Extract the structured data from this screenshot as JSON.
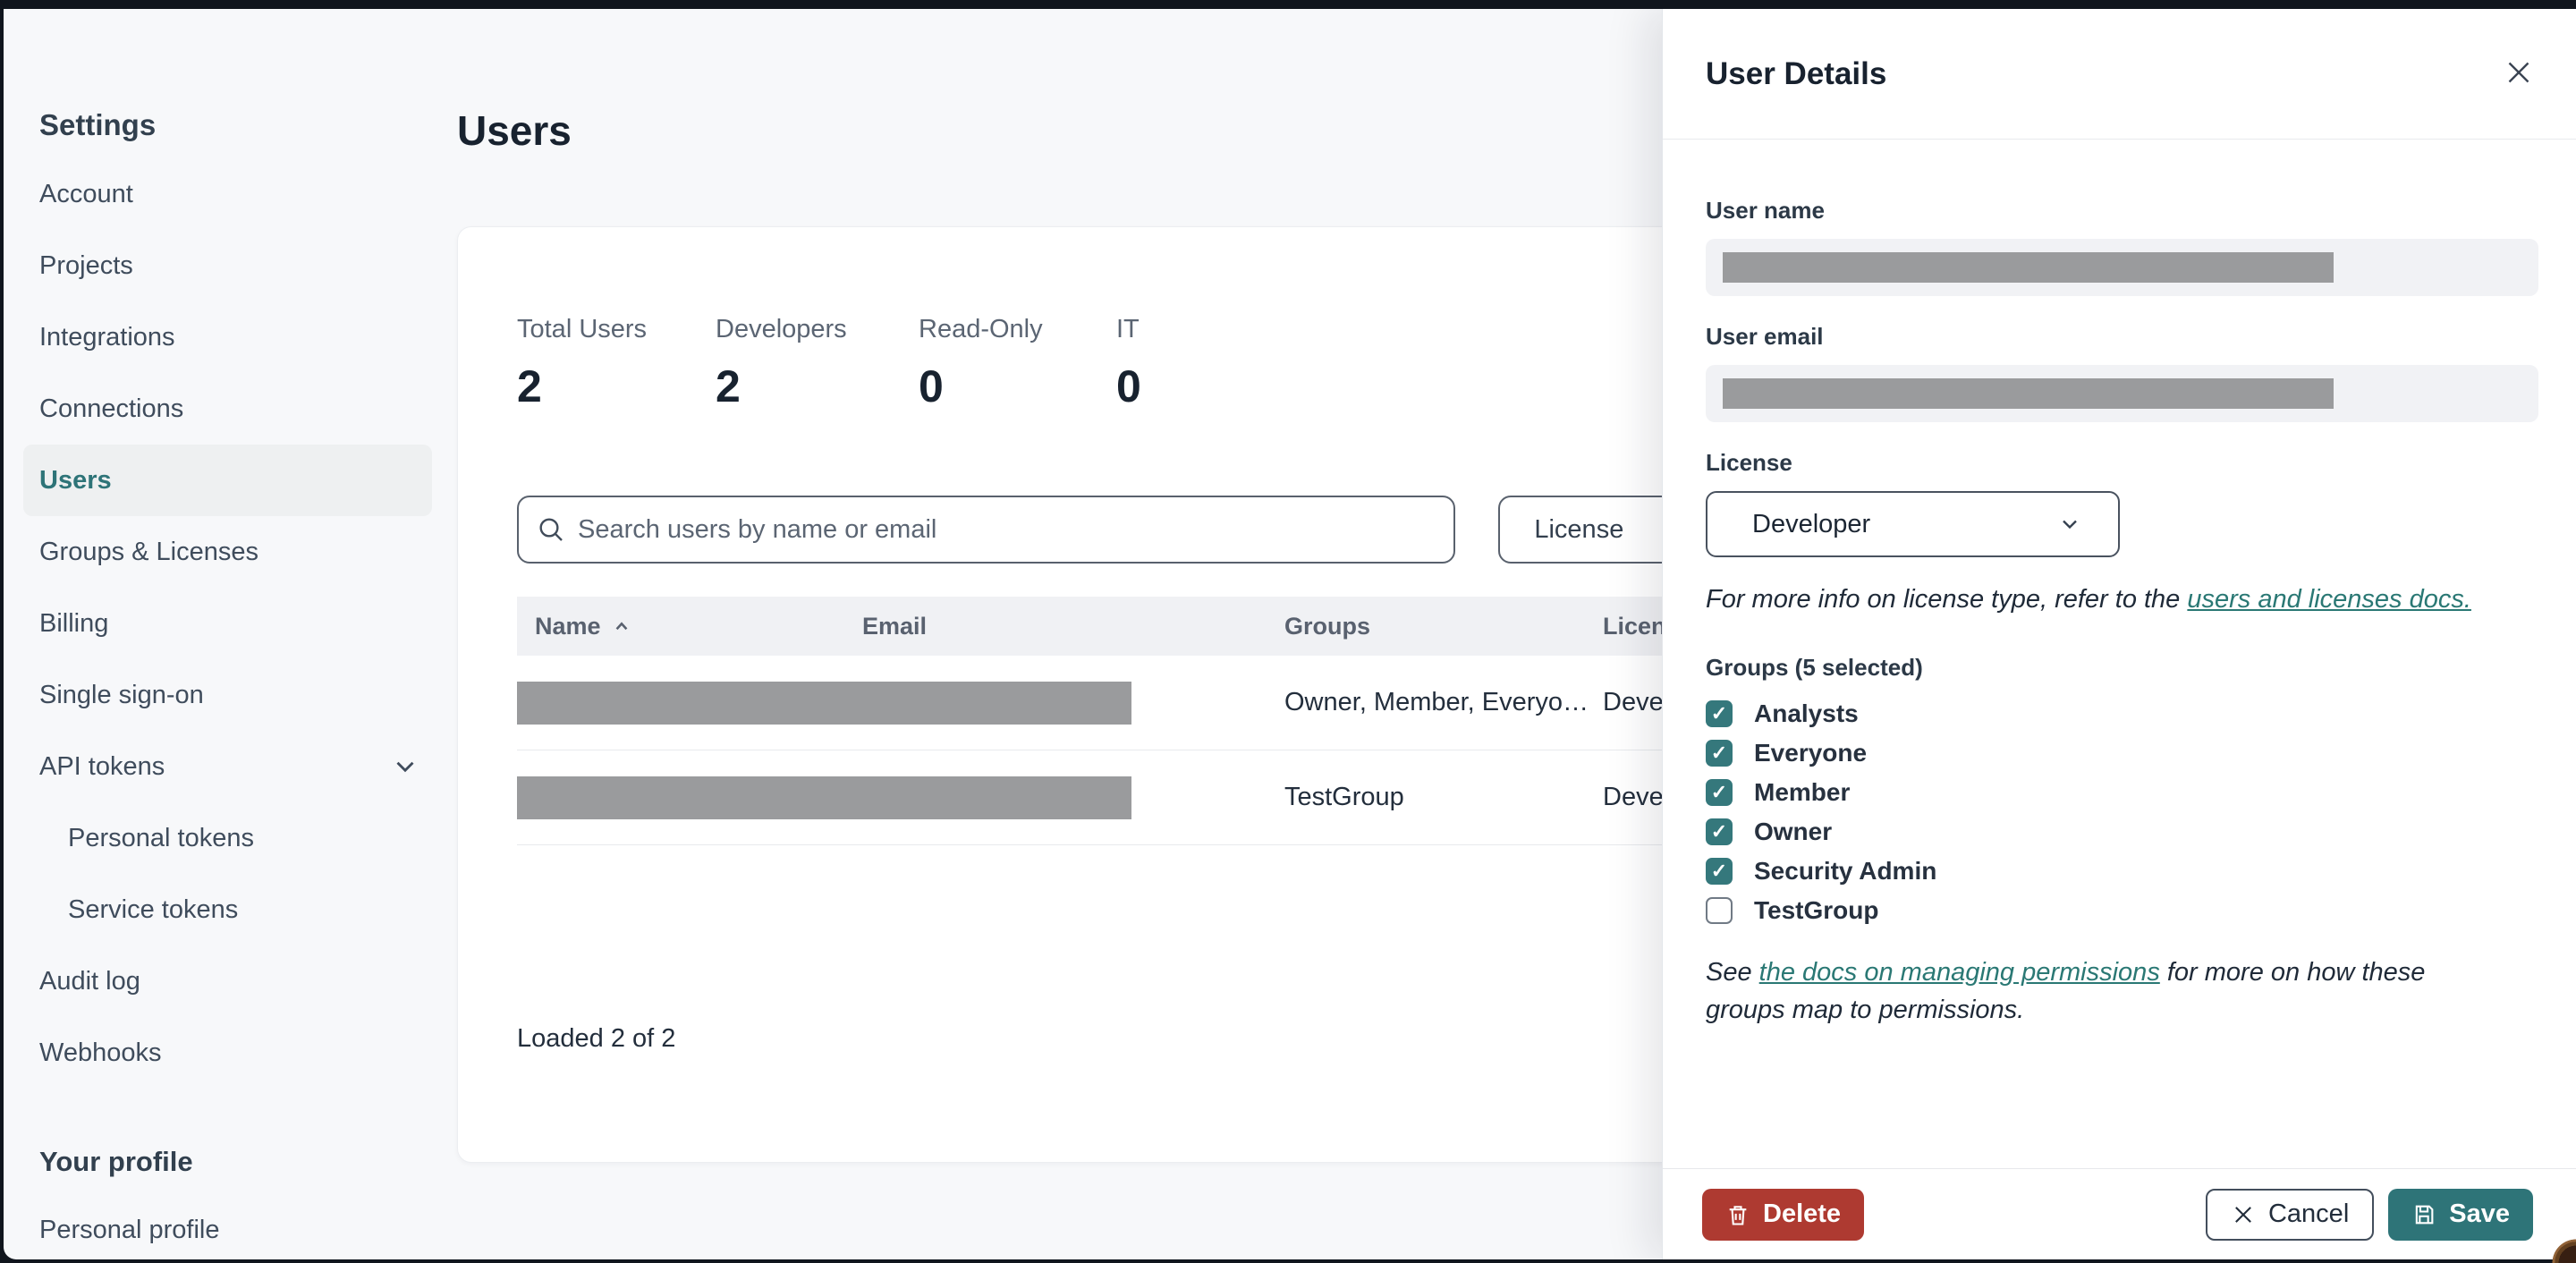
{
  "colors": {
    "page_bg": "#f7f8fa",
    "accent_teal": "#2e7478",
    "checkbox_teal": "#35787c",
    "link_teal": "#2a7874",
    "danger_red": "#ae3a31",
    "redaction_gray": "#9a9b9d",
    "input_bg": "#f1f2f5",
    "topbar": "#10151d"
  },
  "sidebar": {
    "heading": "Settings",
    "items": [
      {
        "label": "Account"
      },
      {
        "label": "Projects"
      },
      {
        "label": "Integrations"
      },
      {
        "label": "Connections"
      },
      {
        "label": "Users",
        "active": true
      },
      {
        "label": "Groups & Licenses"
      },
      {
        "label": "Billing"
      },
      {
        "label": "Single sign-on"
      },
      {
        "label": "API tokens",
        "expandable": true
      },
      {
        "label": "Personal tokens",
        "child": true
      },
      {
        "label": "Service tokens",
        "child": true
      },
      {
        "label": "Audit log"
      },
      {
        "label": "Webhooks"
      }
    ],
    "profile_heading": "Your profile",
    "profile_item": "Personal profile"
  },
  "main": {
    "title": "Users",
    "stats": [
      {
        "label": "Total Users",
        "value": "2"
      },
      {
        "label": "Developers",
        "value": "2"
      },
      {
        "label": "Read-Only",
        "value": "0"
      },
      {
        "label": "IT",
        "value": "0"
      }
    ],
    "search_placeholder": "Search users by name or email",
    "license_filter": "License",
    "table": {
      "col_name": "Name",
      "col_email": "Email",
      "col_groups": "Groups",
      "col_license": "License",
      "rows": [
        {
          "groups": "Owner, Member, Everyo…",
          "license": "Developer"
        },
        {
          "groups": "TestGroup",
          "license": "Developer"
        }
      ]
    },
    "loaded": "Loaded 2 of 2"
  },
  "drawer": {
    "title": "User Details",
    "user_name_label": "User name",
    "user_email_label": "User email",
    "license_label": "License",
    "license_value": "Developer",
    "license_note_prefix": "For more info on license type, refer to the ",
    "license_note_link": "users and licenses docs.",
    "groups_label": "Groups (5 selected)",
    "groups": [
      {
        "label": "Analysts",
        "checked": true
      },
      {
        "label": "Everyone",
        "checked": true
      },
      {
        "label": "Member",
        "checked": true
      },
      {
        "label": "Owner",
        "checked": true
      },
      {
        "label": "Security Admin",
        "checked": true
      },
      {
        "label": "TestGroup",
        "checked": false
      }
    ],
    "permissions_note_prefix": "See ",
    "permissions_note_link": "the docs on managing permissions",
    "permissions_note_suffix": " for more on how these groups map to permissions.",
    "delete_label": "Delete",
    "cancel_label": "Cancel",
    "save_label": "Save"
  }
}
